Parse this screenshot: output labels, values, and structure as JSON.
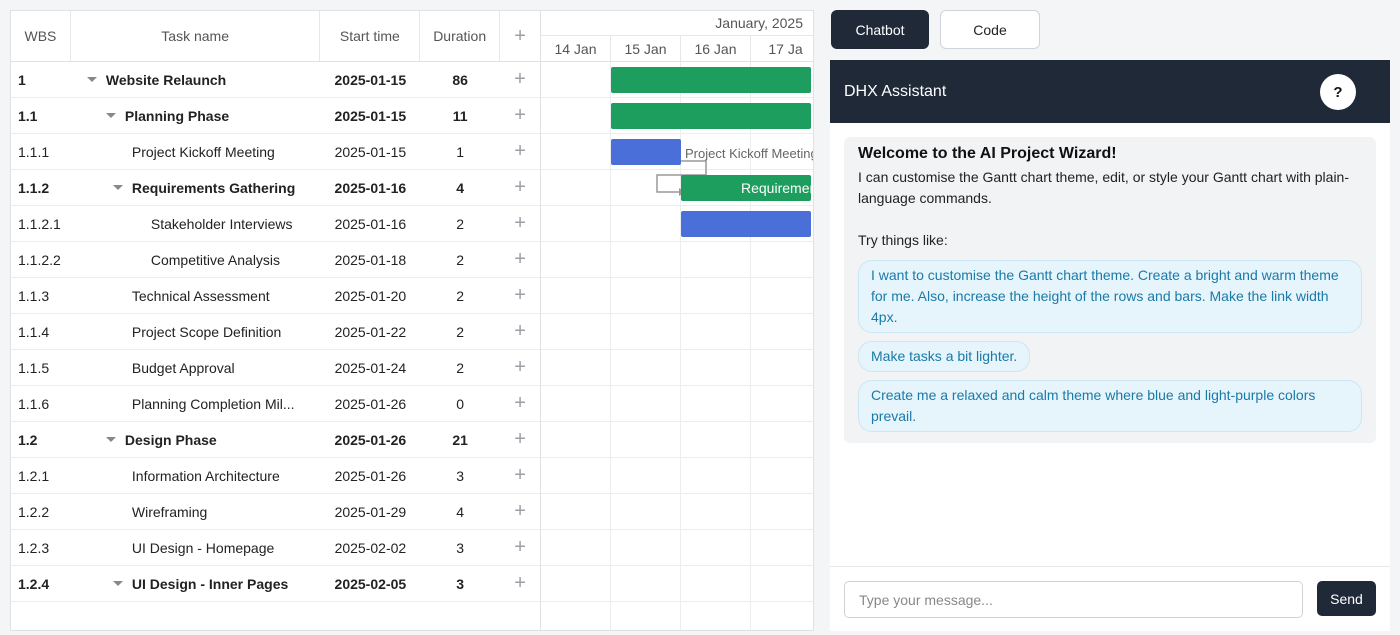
{
  "gantt": {
    "headers": {
      "wbs": "WBS",
      "name": "Task name",
      "start": "Start time",
      "duration": "Duration",
      "add": "+"
    },
    "scale": {
      "month": "January, 2025",
      "days": [
        "14 Jan",
        "15 Jan",
        "16 Jan",
        "17 Ja"
      ]
    },
    "rows": [
      {
        "wbs": "1",
        "name": "Website Relaunch",
        "start": "2025-01-15",
        "duration": "86",
        "level": 0,
        "parent": true,
        "add": "+"
      },
      {
        "wbs": "1.1",
        "name": "Planning Phase",
        "start": "2025-01-15",
        "duration": "11",
        "level": 1,
        "parent": true,
        "add": "+"
      },
      {
        "wbs": "1.1.1",
        "name": "Project Kickoff Meeting",
        "start": "2025-01-15",
        "duration": "1",
        "level": 2,
        "parent": false,
        "add": "+"
      },
      {
        "wbs": "1.1.2",
        "name": "Requirements Gathering",
        "start": "2025-01-16",
        "duration": "4",
        "level": 2,
        "parent": true,
        "add": "+"
      },
      {
        "wbs": "1.1.2.1",
        "name": "Stakeholder Interviews",
        "start": "2025-01-16",
        "duration": "2",
        "level": 3,
        "parent": false,
        "add": "+"
      },
      {
        "wbs": "1.1.2.2",
        "name": "Competitive Analysis",
        "start": "2025-01-18",
        "duration": "2",
        "level": 3,
        "parent": false,
        "add": "+"
      },
      {
        "wbs": "1.1.3",
        "name": "Technical Assessment",
        "start": "2025-01-20",
        "duration": "2",
        "level": 2,
        "parent": false,
        "add": "+"
      },
      {
        "wbs": "1.1.4",
        "name": "Project Scope Definition",
        "start": "2025-01-22",
        "duration": "2",
        "level": 2,
        "parent": false,
        "add": "+"
      },
      {
        "wbs": "1.1.5",
        "name": "Budget Approval",
        "start": "2025-01-24",
        "duration": "2",
        "level": 2,
        "parent": false,
        "add": "+"
      },
      {
        "wbs": "1.1.6",
        "name": "Planning Completion Mil...",
        "start": "2025-01-26",
        "duration": "0",
        "level": 2,
        "parent": false,
        "add": "+"
      },
      {
        "wbs": "1.2",
        "name": "Design Phase",
        "start": "2025-01-26",
        "duration": "21",
        "level": 1,
        "parent": true,
        "add": "+"
      },
      {
        "wbs": "1.2.1",
        "name": "Information Architecture",
        "start": "2025-01-26",
        "duration": "3",
        "level": 2,
        "parent": false,
        "add": "+"
      },
      {
        "wbs": "1.2.2",
        "name": "Wireframing",
        "start": "2025-01-29",
        "duration": "4",
        "level": 2,
        "parent": false,
        "add": "+"
      },
      {
        "wbs": "1.2.3",
        "name": "UI Design - Homepage",
        "start": "2025-02-02",
        "duration": "3",
        "level": 2,
        "parent": false,
        "add": "+"
      },
      {
        "wbs": "1.2.4",
        "name": "UI Design - Inner Pages",
        "start": "2025-02-05",
        "duration": "3",
        "level": 2,
        "parent": true,
        "add": "+"
      }
    ],
    "bar_labels": {
      "kickoff": "Project Kickoff Meeting",
      "requirements": "Requirements Gathering"
    },
    "colors": {
      "summary": "#1e9e5e",
      "task": "#4a6fd8"
    }
  },
  "tabs": {
    "chatbot": "Chatbot",
    "code": "Code"
  },
  "assistant": {
    "title": "DHX Assistant",
    "help": "?",
    "welcome_title": "Welcome to the AI Project Wizard!",
    "welcome_text": "I can customise the Gantt chart theme, edit, or style your Gantt chart with plain-language commands.",
    "try_label": "Try things like:",
    "suggestions": [
      "I want to customise the Gantt chart theme. Create a bright and warm theme for me. Also, increase the height of the rows and bars. Make the link width 4px.",
      "Make tasks a bit lighter.",
      "Create me a relaxed and calm theme where blue and light-purple colors prevail."
    ],
    "input_placeholder": "Type your message...",
    "send_label": "Send"
  }
}
